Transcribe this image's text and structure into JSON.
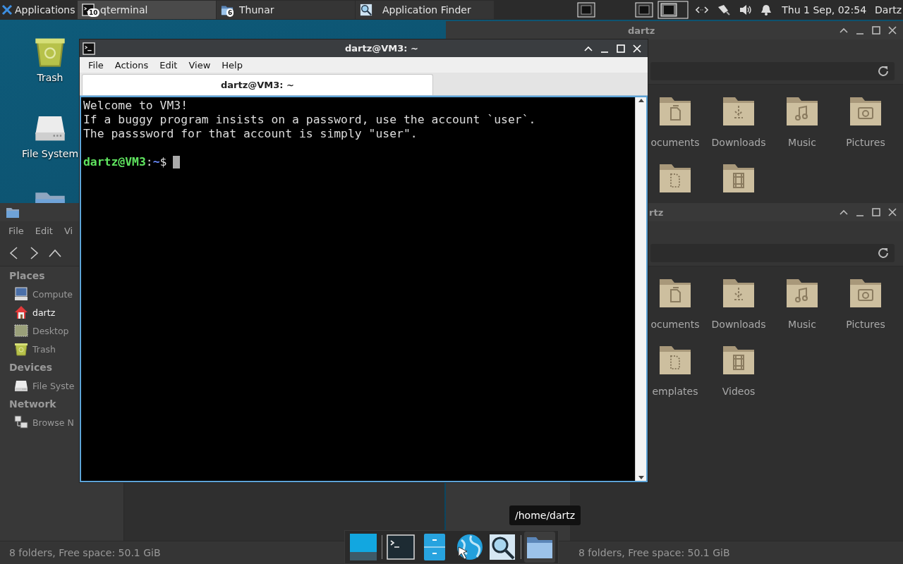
{
  "top_panel": {
    "applications_menu": "Applications",
    "tasks": [
      {
        "label": "qterminal",
        "badge": "10",
        "kind": "terminal",
        "selected": true
      },
      {
        "label": "Thunar",
        "badge": "6",
        "kind": "files",
        "selected": false
      },
      {
        "label": "Application Finder",
        "kind": "finder",
        "selected": false
      }
    ],
    "clock": "Thu  1 Sep, 02:54",
    "user": "Dartz"
  },
  "desktop_icons": [
    {
      "label": "Trash",
      "kind": "trash"
    },
    {
      "label": "File System",
      "kind": "drive"
    },
    {
      "kind": "folder"
    }
  ],
  "file_manager_left": {
    "menu": [
      "File",
      "Edit",
      "Vi"
    ],
    "sidebar": [
      {
        "heading": "Places",
        "items": [
          {
            "label": "Compute",
            "kind": "computer",
            "selected": false
          },
          {
            "label": "dartz",
            "kind": "home",
            "selected": true
          },
          {
            "label": "Desktop",
            "kind": "desktop",
            "selected": false
          },
          {
            "label": "Trash",
            "kind": "trash",
            "selected": false
          }
        ]
      },
      {
        "heading": "Devices",
        "items": [
          {
            "label": "File Syste",
            "kind": "drive",
            "selected": false
          }
        ]
      },
      {
        "heading": "Network",
        "items": [
          {
            "label": "Browse N",
            "kind": "network",
            "selected": false
          }
        ]
      }
    ],
    "status": "8 folders, Free space: 50.1 GiB"
  },
  "file_manager_top": {
    "title": "dartz",
    "folders": [
      {
        "label": "ocuments",
        "kind": "documents"
      },
      {
        "label": "Downloads",
        "kind": "downloads"
      },
      {
        "label": "Music",
        "kind": "music"
      },
      {
        "label": "Pictures",
        "kind": "pictures"
      },
      {
        "kind": "templates"
      },
      {
        "kind": "videos"
      }
    ]
  },
  "file_manager_bottom": {
    "title": "rtz",
    "folders": [
      {
        "label": "ocuments",
        "kind": "documents"
      },
      {
        "label": "Downloads",
        "kind": "downloads"
      },
      {
        "label": "Music",
        "kind": "music"
      },
      {
        "label": "Pictures",
        "kind": "pictures"
      },
      {
        "label": "emplates",
        "kind": "templates"
      },
      {
        "label": "Videos",
        "kind": "videos"
      }
    ],
    "status": "8 folders, Free space: 50.1 GiB"
  },
  "terminal": {
    "title": "dartz@VM3: ~",
    "menu": [
      "File",
      "Actions",
      "Edit",
      "View",
      "Help"
    ],
    "tabs": [
      {
        "label": "dartz@VM3: ~",
        "selected": true
      }
    ],
    "output": [
      "Welcome to VM3!",
      "If a buggy program insists on a password, use the account `user`.",
      "The passsword for that account is simply \"user\"."
    ],
    "prompt": {
      "user_host": "dartz@VM3",
      "separator": ":",
      "path": "~",
      "symbol": "$"
    }
  },
  "dock": {
    "items": [
      {
        "kind": "display",
        "selected": false
      },
      {
        "kind": "terminal",
        "selected": false
      },
      {
        "kind": "cabinet",
        "selected": false
      },
      {
        "kind": "browser",
        "selected": false
      },
      {
        "kind": "finder",
        "selected": false
      },
      {
        "kind": "folder",
        "selected": true
      }
    ],
    "tooltip": "/home/dartz"
  }
}
